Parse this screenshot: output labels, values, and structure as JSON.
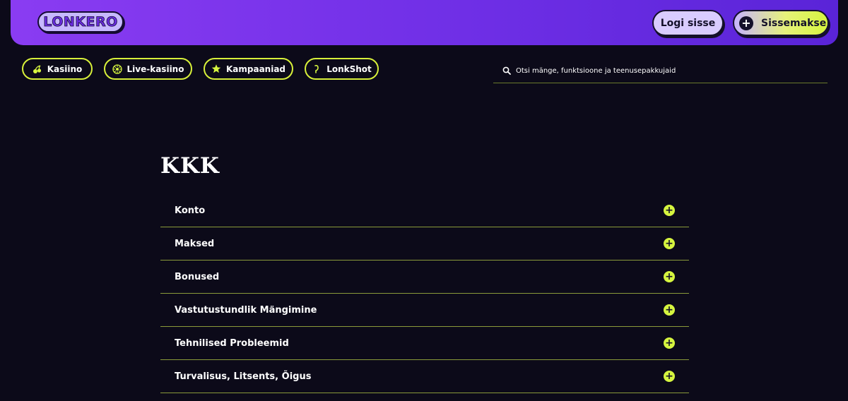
{
  "header": {
    "logo_text": "LONKERO",
    "login_label": "Logi sisse",
    "deposit_label": "Sissemakse"
  },
  "nav": {
    "items": [
      {
        "label": "Kasiino",
        "icon": "cherry-icon"
      },
      {
        "label": "Live-kasiino",
        "icon": "roulette-icon"
      },
      {
        "label": "Kampaaniad",
        "icon": "star-icon"
      },
      {
        "label": "LonkShot",
        "icon": "lonkshot-icon"
      }
    ]
  },
  "search": {
    "placeholder": "Otsi mänge, funktsioone ja teenusepakkujaid",
    "icon": "search-icon"
  },
  "main": {
    "title": "KKK",
    "faq": [
      {
        "label": "Konto"
      },
      {
        "label": "Maksed"
      },
      {
        "label": "Bonused"
      },
      {
        "label": "Vastutustundlik Mängimine"
      },
      {
        "label": "Tehnilised Probleemid"
      },
      {
        "label": "Turvalisus, Litsents, Õigus"
      }
    ]
  },
  "colors": {
    "background": "#0c0a19",
    "header_purple": "#7a33ea",
    "accent_lime": "#d6f53f"
  }
}
